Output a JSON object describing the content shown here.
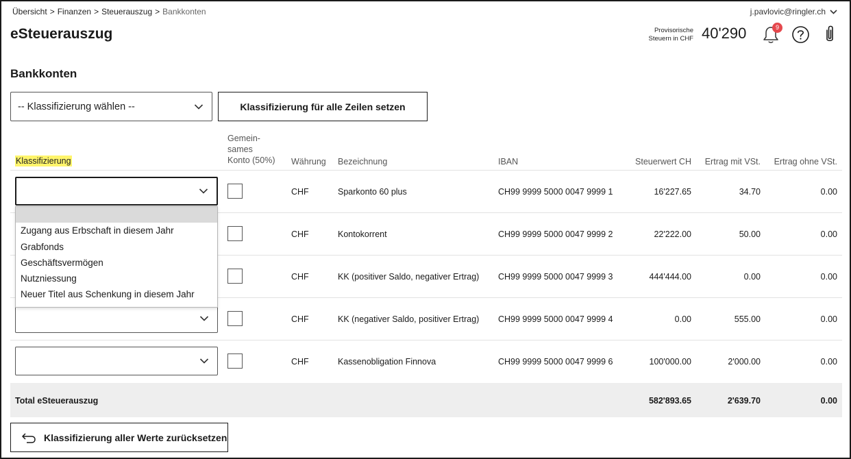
{
  "breadcrumb": {
    "items": [
      "Übersicht",
      "Finanzen",
      "Steuerauszug"
    ],
    "current": "Bankkonten",
    "separator": ">"
  },
  "user": {
    "email": "j.pavlovic@ringler.ch",
    "icon": "chevron-down-icon"
  },
  "header": {
    "title": "eSteuerauszug",
    "tax_label_line1": "Provisorische",
    "tax_label_line2": "Steuern in CHF",
    "tax_value": "40'290",
    "notification_count": "9"
  },
  "section": {
    "title": "Bankkonten"
  },
  "toolbar": {
    "select_value": "-- Klassifizierung wählen --",
    "set_all_label": "Klassifizierung für alle Zeilen setzen"
  },
  "table": {
    "headers": {
      "klassifizierung": "Klassifizierung",
      "gemeinsam_line1": "Gemein-",
      "gemeinsam_line2": "sames",
      "gemeinsam_line3": "Konto (50%)",
      "waehrung": "Währung",
      "bezeichnung": "Bezeichnung",
      "iban": "IBAN",
      "steuerwert": "Steuerwert CH",
      "ertrag_mit": "Ertrag mit VSt.",
      "ertrag_ohne": "Ertrag ohne VSt."
    },
    "rows": [
      {
        "waehrung": "CHF",
        "bezeichnung": "Sparkonto 60 plus",
        "iban": "CH99 9999 5000 0047 9999 1",
        "steuerwert": "16'227.65",
        "ertrag_mit": "34.70",
        "ertrag_ohne": "0.00"
      },
      {
        "waehrung": "CHF",
        "bezeichnung": "Kontokorrent",
        "iban": "CH99 9999 5000 0047 9999 2",
        "steuerwert": "22'222.00",
        "ertrag_mit": "50.00",
        "ertrag_ohne": "0.00"
      },
      {
        "waehrung": "CHF",
        "bezeichnung": "KK (positiver Saldo, negativer Ertrag)",
        "iban": "CH99 9999 5000 0047 9999 3",
        "steuerwert": "444'444.00",
        "ertrag_mit": "0.00",
        "ertrag_ohne": "0.00"
      },
      {
        "waehrung": "CHF",
        "bezeichnung": "KK (negativer Saldo, positiver Ertrag)",
        "iban": "CH99 9999 5000 0047 9999 4",
        "steuerwert": "0.00",
        "ertrag_mit": "555.00",
        "ertrag_ohne": "0.00"
      },
      {
        "waehrung": "CHF",
        "bezeichnung": "Kassenobligation Finnova",
        "iban": "CH99 9999 5000 0047 9999 6",
        "steuerwert": "100'000.00",
        "ertrag_mit": "2'000.00",
        "ertrag_ohne": "0.00"
      }
    ],
    "total": {
      "label": "Total eSteuerauszug",
      "steuerwert": "582'893.65",
      "ertrag_mit": "2'639.70",
      "ertrag_ohne": "0.00"
    }
  },
  "dropdown": {
    "options": [
      "",
      "Zugang aus Erbschaft in diesem Jahr",
      "Grabfonds",
      "Geschäftsvermögen",
      "Nutzniessung",
      "Neuer Titel aus Schenkung in diesem Jahr"
    ]
  },
  "reset": {
    "label": "Klassifizierung aller Werte zurücksetzen"
  },
  "colors": {
    "highlight": "#fff56b",
    "badge": "#e5484d",
    "total_band": "#eeeeee"
  }
}
